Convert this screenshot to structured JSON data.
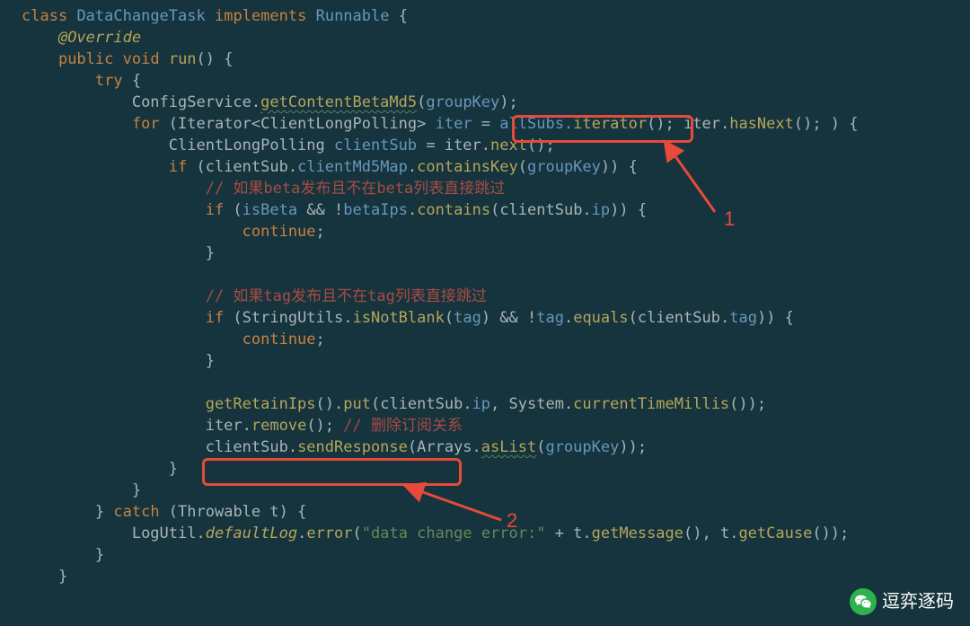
{
  "code": {
    "l1_kw1": "class",
    "l1_name": "DataChangeTask",
    "l1_kw2": "implements",
    "l1_name2": "Runnable",
    "l1_brace": "{",
    "l2_ann": "@Override",
    "l3_kw1": "public",
    "l3_kw2": "void",
    "l3_fn": "run",
    "l3_rest": "() {",
    "l4_kw": "try",
    "l4_brace": "{",
    "l5_a": "ConfigService.",
    "l5_fn": "getContentBetaMd5",
    "l5_b": "(",
    "l5_c": "groupKey",
    "l5_d": ");",
    "l6_kw": "for",
    "l6_a": "(Iterator<ClientLongPolling> ",
    "l6_iter": "iter",
    "l6_b": " = ",
    "l6_c": "allSubs.",
    "l6_fn": "iterator",
    "l6_d": "();",
    "l6_e": " iter.",
    "l6_fn2": "hasNext",
    "l6_f": "(); ) {",
    "l7_a": "ClientLongPolling ",
    "l7_b": "clientSub",
    "l7_c": " = iter.",
    "l7_fn": "next",
    "l7_d": "();",
    "l8_kw": "if",
    "l8_a": " (clientSub.",
    "l8_b": "clientMd5Map",
    "l8_c": ".",
    "l8_fn": "containsKey",
    "l8_d": "(",
    "l8_e": "groupKey",
    "l8_f": ")) {",
    "l9_cmt": "// 如果beta发布且不在beta列表直接跳过",
    "l10_kw": "if",
    "l10_a": " (",
    "l10_b": "isBeta",
    "l10_c": " && !",
    "l10_d": "betaIps",
    "l10_e": ".",
    "l10_fn": "contains",
    "l10_f": "(clientSub.",
    "l10_g": "ip",
    "l10_h": ")) {",
    "l11_kw": "continue",
    "l11_a": ";",
    "l12_a": "}",
    "l14_cmt": "// 如果tag发布且不在tag列表直接跳过",
    "l15_kw": "if",
    "l15_a": " (StringUtils.",
    "l15_fn": "isNotBlank",
    "l15_b": "(",
    "l15_c": "tag",
    "l15_d": ") && !",
    "l15_e": "tag",
    "l15_f": ".",
    "l15_fn2": "equals",
    "l15_g": "(clientSub.",
    "l15_h": "tag",
    "l15_i": ")) {",
    "l16_kw": "continue",
    "l16_a": ";",
    "l17_a": "}",
    "l19_fn": "getRetainIps",
    "l19_a": "().",
    "l19_fn2": "put",
    "l19_b": "(clientSub.",
    "l19_c": "ip",
    "l19_d": ", System.",
    "l19_fn3": "currentTimeMillis",
    "l19_e": "());",
    "l20_a": "iter.",
    "l20_fn": "remove",
    "l20_b": "(); ",
    "l20_cmt": "// 删除订阅关系",
    "l21_a": "clientSub.",
    "l21_fn": "sendResponse",
    "l21_b": "(Arrays.",
    "l21_fn2": "asList",
    "l21_c": "(",
    "l21_d": "groupKey",
    "l21_e": "));",
    "l22_a": "}",
    "l23_a": "}",
    "l24_a": "} ",
    "l24_kw": "catch",
    "l24_b": " (Throwable t) {",
    "l25_a": "LogUtil.",
    "l25_b": "defaultLog",
    "l25_c": ".",
    "l25_fn": "error",
    "l25_d": "(",
    "l25_str": "\"data change error:\"",
    "l25_e": " + t.",
    "l25_fn2": "getMessage",
    "l25_f": "(), t.",
    "l25_fn3": "getCause",
    "l25_g": "());",
    "l26_a": "}",
    "l27_a": "}"
  },
  "annotations": {
    "label1": "1",
    "label2": "2"
  },
  "watermark": "逗弈逐码"
}
